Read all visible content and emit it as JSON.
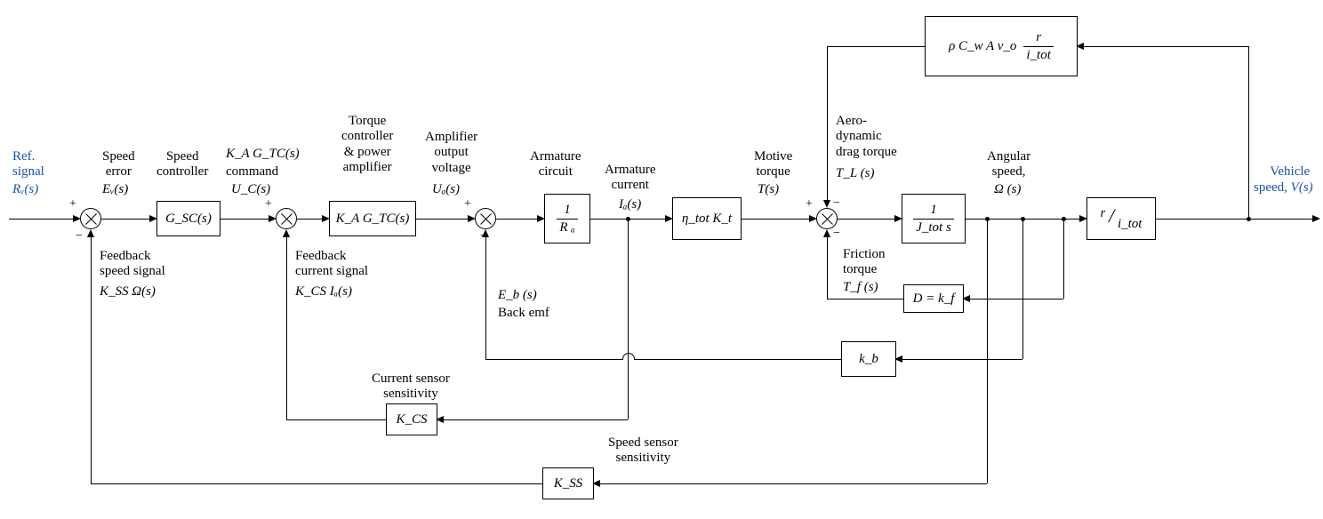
{
  "inputs": {
    "ref_label": "Ref.\nsignal",
    "ref_sym": "Rᵥ(s)",
    "output_label": "Vehicle\nspeed, ",
    "output_sym": "V(s)"
  },
  "signals": {
    "speed_error_label": "Speed\nerror",
    "speed_error_sym": "Eᵥ(s)",
    "uc_label": "command",
    "uc_top": "K_A G_TC(s)",
    "uc_sym": "U_C(s)",
    "ua_label": "Amplifier\noutput\nvoltage",
    "ua_sym": "Uₐ(s)",
    "ia_label": "Armature\ncurrent",
    "ia_sym": "Iₐ(s)",
    "t_label": "Motive\ntorque",
    "t_sym": "T(s)",
    "tl_label": "Aero-\ndynamic\ndrag torque",
    "tl_sym": "T_L (s)",
    "tf_label": "Friction\ntorque",
    "tf_sym": "T_f (s)",
    "omega_label": "Angular\nspeed,",
    "omega_sym": "Ω (s)",
    "eb_sym": "E_b (s)",
    "eb_label": "Back emf",
    "fb_speed_label": "Feedback\nspeed signal",
    "fb_speed_sym": "K_SS Ω(s)",
    "fb_cur_label": "Feedback\ncurrent signal",
    "fb_cur_sym": "K_CS Iₐ(s)"
  },
  "blocks": {
    "gsc_label": "Speed\ncontroller",
    "gsc": "G_SC(s)",
    "ka_gtc_label": "Torque\ncontroller\n& power\namplifier",
    "ka_gtc": "K_A G_TC(s)",
    "ra_label": "Armature\ncircuit",
    "ra_num": "1",
    "ra_den": "R ₐ",
    "kt": "η_tot K_t",
    "jtot_num": "1",
    "jtot_den": "J_tot s",
    "ritot_num": "r",
    "ritot_den": "i_tot",
    "aero_prefix": "ρ C_w A v_o",
    "aero_num": "r",
    "aero_den": "i_tot",
    "d_eq": "D = k_f",
    "kb": "k_b",
    "kcs_label": "Current sensor\nsensitivity",
    "kcs": "K_CS",
    "kss_label": "Speed sensor\nsensitivity",
    "kss": "K_SS"
  },
  "signs": {
    "plus": "+",
    "minus": "−"
  }
}
